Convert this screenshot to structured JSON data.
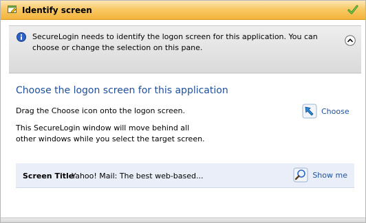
{
  "window": {
    "title": "Identify screen",
    "accent_color": "#f3b43c"
  },
  "info": {
    "text": "SecureLogin needs to identify the logon screen for this application. You can choose or change the selection on this pane."
  },
  "main": {
    "heading": "Choose the logon screen for this application",
    "instruction": "Drag the Choose icon onto the logon screen.",
    "note": "This SecureLogin window will move behind all other windows while you select the target screen.",
    "choose_label": "Choose"
  },
  "screen_title": {
    "label": "Screen Title",
    "value": "Yahoo! Mail: The best web-based...",
    "show_label": "Show me"
  },
  "icons": {
    "app": "window-app-icon",
    "ok": "green-check-icon",
    "info": "info-icon",
    "collapse": "chevron-up-icon",
    "choose": "pointer-arrow-icon",
    "show": "magnifier-icon"
  }
}
